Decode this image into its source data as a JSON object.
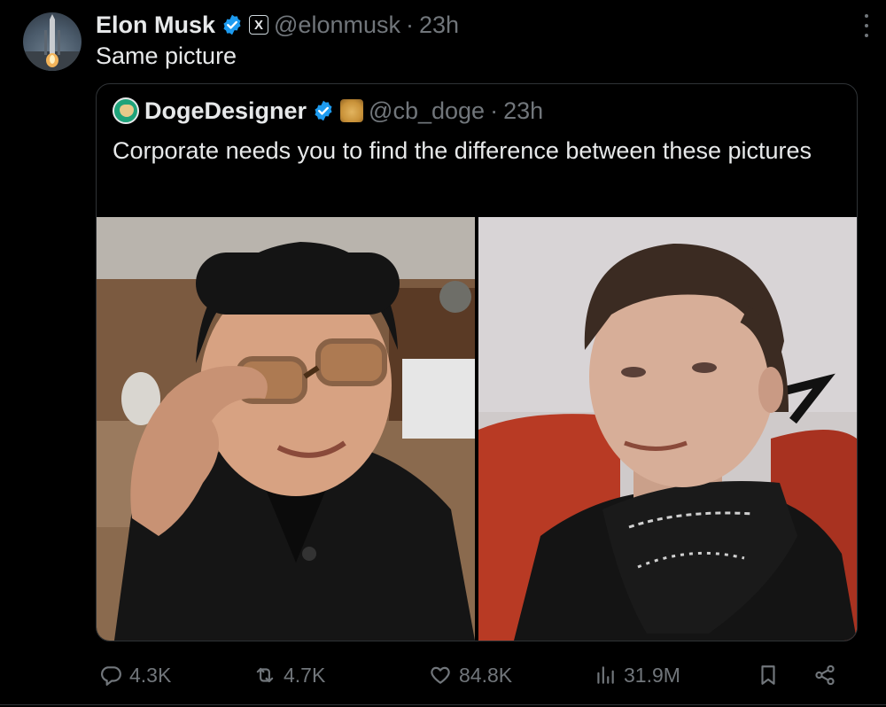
{
  "tweet": {
    "author_name": "Elon Musk",
    "handle": "@elonmusk",
    "separator": "·",
    "time": "23h",
    "affiliate_badge": "X",
    "text": "Same picture",
    "avatar_icon": "rocket-launch-avatar",
    "more_icon": "more-vertical-icon"
  },
  "quote": {
    "author_name": "DogeDesigner",
    "handle": "@cb_doge",
    "separator": "·",
    "time": "23h",
    "text": "Corporate needs you to find the difference between these pictures",
    "affiliate_icon": "doge-affiliate-badge",
    "images": [
      {
        "name": "left-photo",
        "description_icon": "photo"
      },
      {
        "name": "right-photo",
        "description_icon": "photo"
      }
    ]
  },
  "actions": {
    "replies": "4.3K",
    "reposts": "4.7K",
    "likes": "84.8K",
    "views": "31.9M"
  },
  "colors": {
    "background": "#000000",
    "text": "#e7e9ea",
    "muted": "#71767b",
    "verified": "#1d9bf0",
    "border": "#2f3336"
  }
}
